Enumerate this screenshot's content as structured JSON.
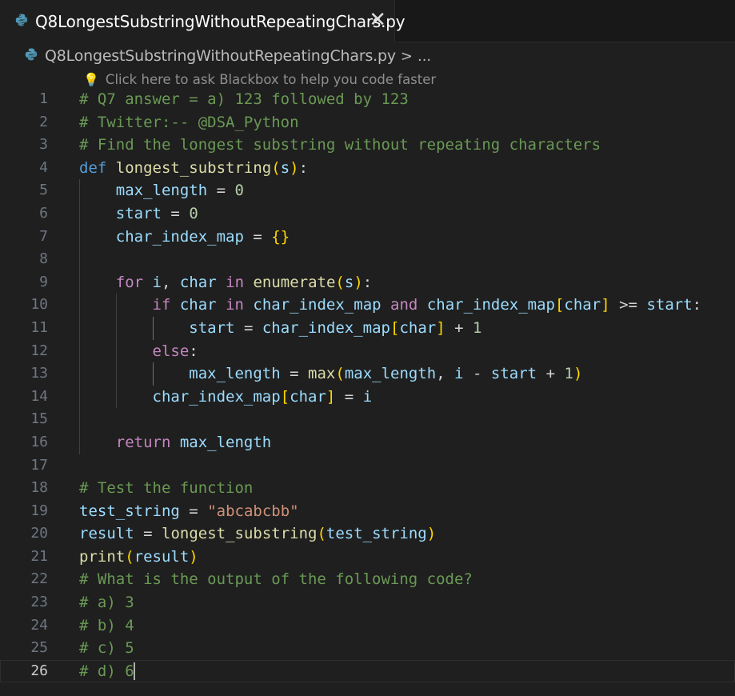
{
  "tab": {
    "title": "Q8LongestSubstringWithoutRepeatingChars.py",
    "close_glyph": "✕",
    "icon": "python-icon"
  },
  "breadcrumb": {
    "file": "Q8LongestSubstringWithoutRepeatingChars.py",
    "separator": ">",
    "more": "..."
  },
  "hint": {
    "icon": "lightbulb-icon",
    "text": "Click here to ask Blackbox to help you code faster"
  },
  "editor": {
    "current_line": 26,
    "lines": [
      {
        "n": "1"
      },
      {
        "n": "2"
      },
      {
        "n": "3"
      },
      {
        "n": "4"
      },
      {
        "n": "5"
      },
      {
        "n": "6"
      },
      {
        "n": "7"
      },
      {
        "n": "8"
      },
      {
        "n": "9"
      },
      {
        "n": "10"
      },
      {
        "n": "11"
      },
      {
        "n": "12"
      },
      {
        "n": "13"
      },
      {
        "n": "14"
      },
      {
        "n": "15"
      },
      {
        "n": "16"
      },
      {
        "n": "17"
      },
      {
        "n": "18"
      },
      {
        "n": "19"
      },
      {
        "n": "20"
      },
      {
        "n": "21"
      },
      {
        "n": "22"
      },
      {
        "n": "23"
      },
      {
        "n": "24"
      },
      {
        "n": "25"
      },
      {
        "n": "26"
      }
    ],
    "code": [
      "# Q7 answer = a) 123 followed by 123",
      "# Twitter:-- @DSA_Python",
      "# Find the longest substring without repeating characters",
      "def longest_substring(s):",
      "    max_length = 0",
      "    start = 0",
      "    char_index_map = {}",
      "",
      "    for i, char in enumerate(s):",
      "        if char in char_index_map and char_index_map[char] >= start:",
      "            start = char_index_map[char] + 1",
      "        else:",
      "            max_length = max(max_length, i - start + 1)",
      "        char_index_map[char] = i",
      "",
      "    return max_length",
      "",
      "# Test the function",
      "test_string = \"abcabcbb\"",
      "result = longest_substring(test_string)",
      "print(result)",
      "# What is the output of the following code?",
      "# a) 3",
      "# b) 4",
      "# c) 5",
      "# d) 6"
    ]
  },
  "colors": {
    "background": "#1f1f1f",
    "comment": "#6a9955",
    "keyword": "#569cd6",
    "control": "#c586c0",
    "function": "#dcdcaa",
    "variable": "#9cdcfe",
    "number": "#b5cea8",
    "string": "#ce9178"
  }
}
